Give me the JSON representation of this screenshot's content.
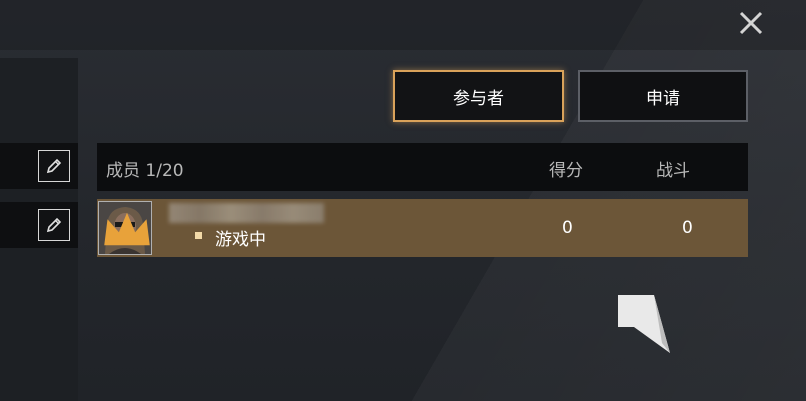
{
  "tabs": {
    "participants_label": "参与者",
    "apply_label": "申请",
    "active": "participants"
  },
  "table": {
    "headers": {
      "members": "成员 1/20",
      "score": "得分",
      "battle": "战斗"
    },
    "rows": [
      {
        "status": "游戏中",
        "score": "0",
        "battle": "0",
        "is_leader": true
      }
    ]
  },
  "icons": {
    "close": "close-icon",
    "edit": "pencil-icon",
    "crown": "crown-icon"
  },
  "colors": {
    "active_tab_border": "#d9a25a",
    "row_highlight": "#6c5638",
    "status_dot": "#f2d9a8"
  }
}
